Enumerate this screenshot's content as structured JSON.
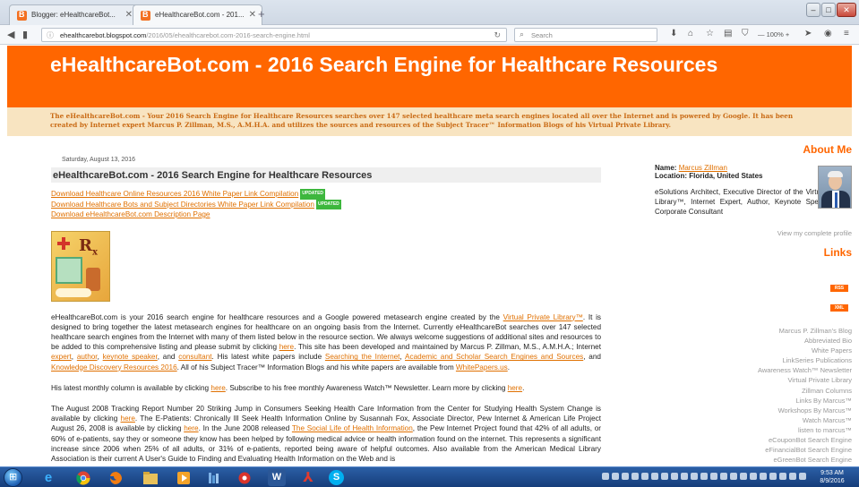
{
  "browser": {
    "tabs": [
      {
        "label": "Blogger: eHealthcareBot..."
      },
      {
        "label": "eHealthcareBot.com - 201..."
      }
    ],
    "new_tab_label": "+",
    "url_host": "ehealthcarebot.blogspot.com",
    "url_path": "/2016/05/ehealthcarebot.com-2016-search-engine.html",
    "search_placeholder": "Search",
    "zoom_label": "— 100% +",
    "accent_color": "#ff6600"
  },
  "page": {
    "site_title": "eHealthcareBot.com - 2016 Search Engine for Healthcare Resources",
    "description": "The eHealthcareBot.com - Your 2016 Search Engine for Healthcare Resources searches over 147 selected healthcare meta search engines located all over the Internet and is powered by Google. It has been created by Internet expert Marcus P. Zillman, M.S., A.M.H.A. and utilizes the sources and resources of the Subject Tracer™ Information Blogs of his Virtual Private Library.",
    "post_date": "Saturday, August 13, 2016",
    "post_title": "eHealthcareBot.com - 2016 Search Engine for Healthcare Resources",
    "downloads": [
      {
        "label": "Download Healthcare Online Resources 2016 White Paper Link Compilation",
        "badge": "UPDATED"
      },
      {
        "label": "Download Healthcare Bots and Subject Directories White Paper Link Compilation",
        "badge": "UPDATED"
      },
      {
        "label": "Download eHealthcareBot.com Description Page",
        "badge": ""
      }
    ],
    "para1": {
      "t1": "eHealthcareBot.com is your 2016 search engine for healthcare resources and a Google powered metasearch engine created by the ",
      "l1": "Virtual Private Library™",
      "t2": ". It is designed to bring together the latest metasearch engines for healthcare on an ongoing basis from the Internet. Currently eHealthcareBot searches over 147 selected healthcare search engines from the Internet with many of them listed below in the resource section. We always welcome suggestions of additional sites and resources to be added to this comprehensive listing and please submit by clicking ",
      "l2": "here",
      "t3": ". This site has been developed and maintained by Marcus P. Zillman, M.S., A.M.H.A.; Internet ",
      "l3": "expert",
      "t4": ", ",
      "l4": "author",
      "t5": ", ",
      "l5": "keynote speaker",
      "t6": ", and ",
      "l6": "consultant",
      "t7": ". His latest white papers include ",
      "l7": "Searching the Internet",
      "t8": ", ",
      "l8": "Academic and Scholar Search Engines and Sources",
      "t9": ", and ",
      "l9": "Knowledge Discovery Resources 2016",
      "t10": ". All of his Subject Tracer™ Information Blogs and his white papers are available from ",
      "l10": "WhitePapers.us",
      "t11": "."
    },
    "para2": {
      "t1": "His latest monthly column is available by clicking ",
      "l1": "here",
      "t2": ". Subscribe to his free monthly Awareness Watch™ Newsletter. Learn more by clicking ",
      "l2": "here",
      "t3": "."
    },
    "para3": {
      "t1": "The August 2008 Tracking Report Number 20 Striking Jump in Consumers Seeking Health Care Information from the Center for Studying Health System Change is available by clicking ",
      "l1": "here",
      "t2": ". The E-Patients: Chronically Ill Seek Health Information Online by Susannah Fox, Associate Director, Pew Internet & American Life Project August 26, 2008 is available by clicking ",
      "l2": "here",
      "t3": ". In the June 2008 released ",
      "l3": "The Social Life of Health Information",
      "t4": ", the Pew Internet Project found that 42% of all adults, or 60% of e-patients, say they or someone they know has been helped by following medical advice or health information found on the internet. This represents a significant increase since 2006 when 25% of all adults, or 31% of e-patients, reported being aware of helpful outcomes. Also available from the American Medical Library Association is their current A User's Guide to Finding and Evaluating Health Information on the Web and is"
    }
  },
  "sidebar": {
    "about_heading": "About Me",
    "name_label": "Name:",
    "name_value": "Marcus Zillman",
    "location_label": "Location:",
    "location_value": "Florida, United States",
    "bio": "eSolutions Architect, Executive Director of the Virtual Private Library™, Internet Expert, Author, Keynote Speaker, and Corporate Consultant",
    "view_profile": "View my complete profile",
    "links_heading": "Links",
    "feed_badges": [
      "RSS",
      "XML"
    ],
    "links": [
      "Marcus P. Zillman's Blog",
      "Abbreviated Bio",
      "White Papers",
      "LinkSeries Publications",
      "Awareness Watch™ Newsletter",
      "Virtual Private Library",
      "Zillman Columns",
      "Links By Marcus™",
      "Workshops By Marcus™",
      "Watch Marcus™",
      "listen to marcus™",
      "eCouponBot Search Engine",
      "eFinancialBot Search Engine",
      "eGreenBot Search Engine"
    ]
  },
  "taskbar": {
    "apps": [
      "IE",
      "Chrome",
      "Firefox",
      "Explorer",
      "Media",
      "Tools",
      "Record",
      "Word",
      "PDF",
      "Skype"
    ],
    "time": "9:53 AM",
    "date": "8/9/2016"
  }
}
